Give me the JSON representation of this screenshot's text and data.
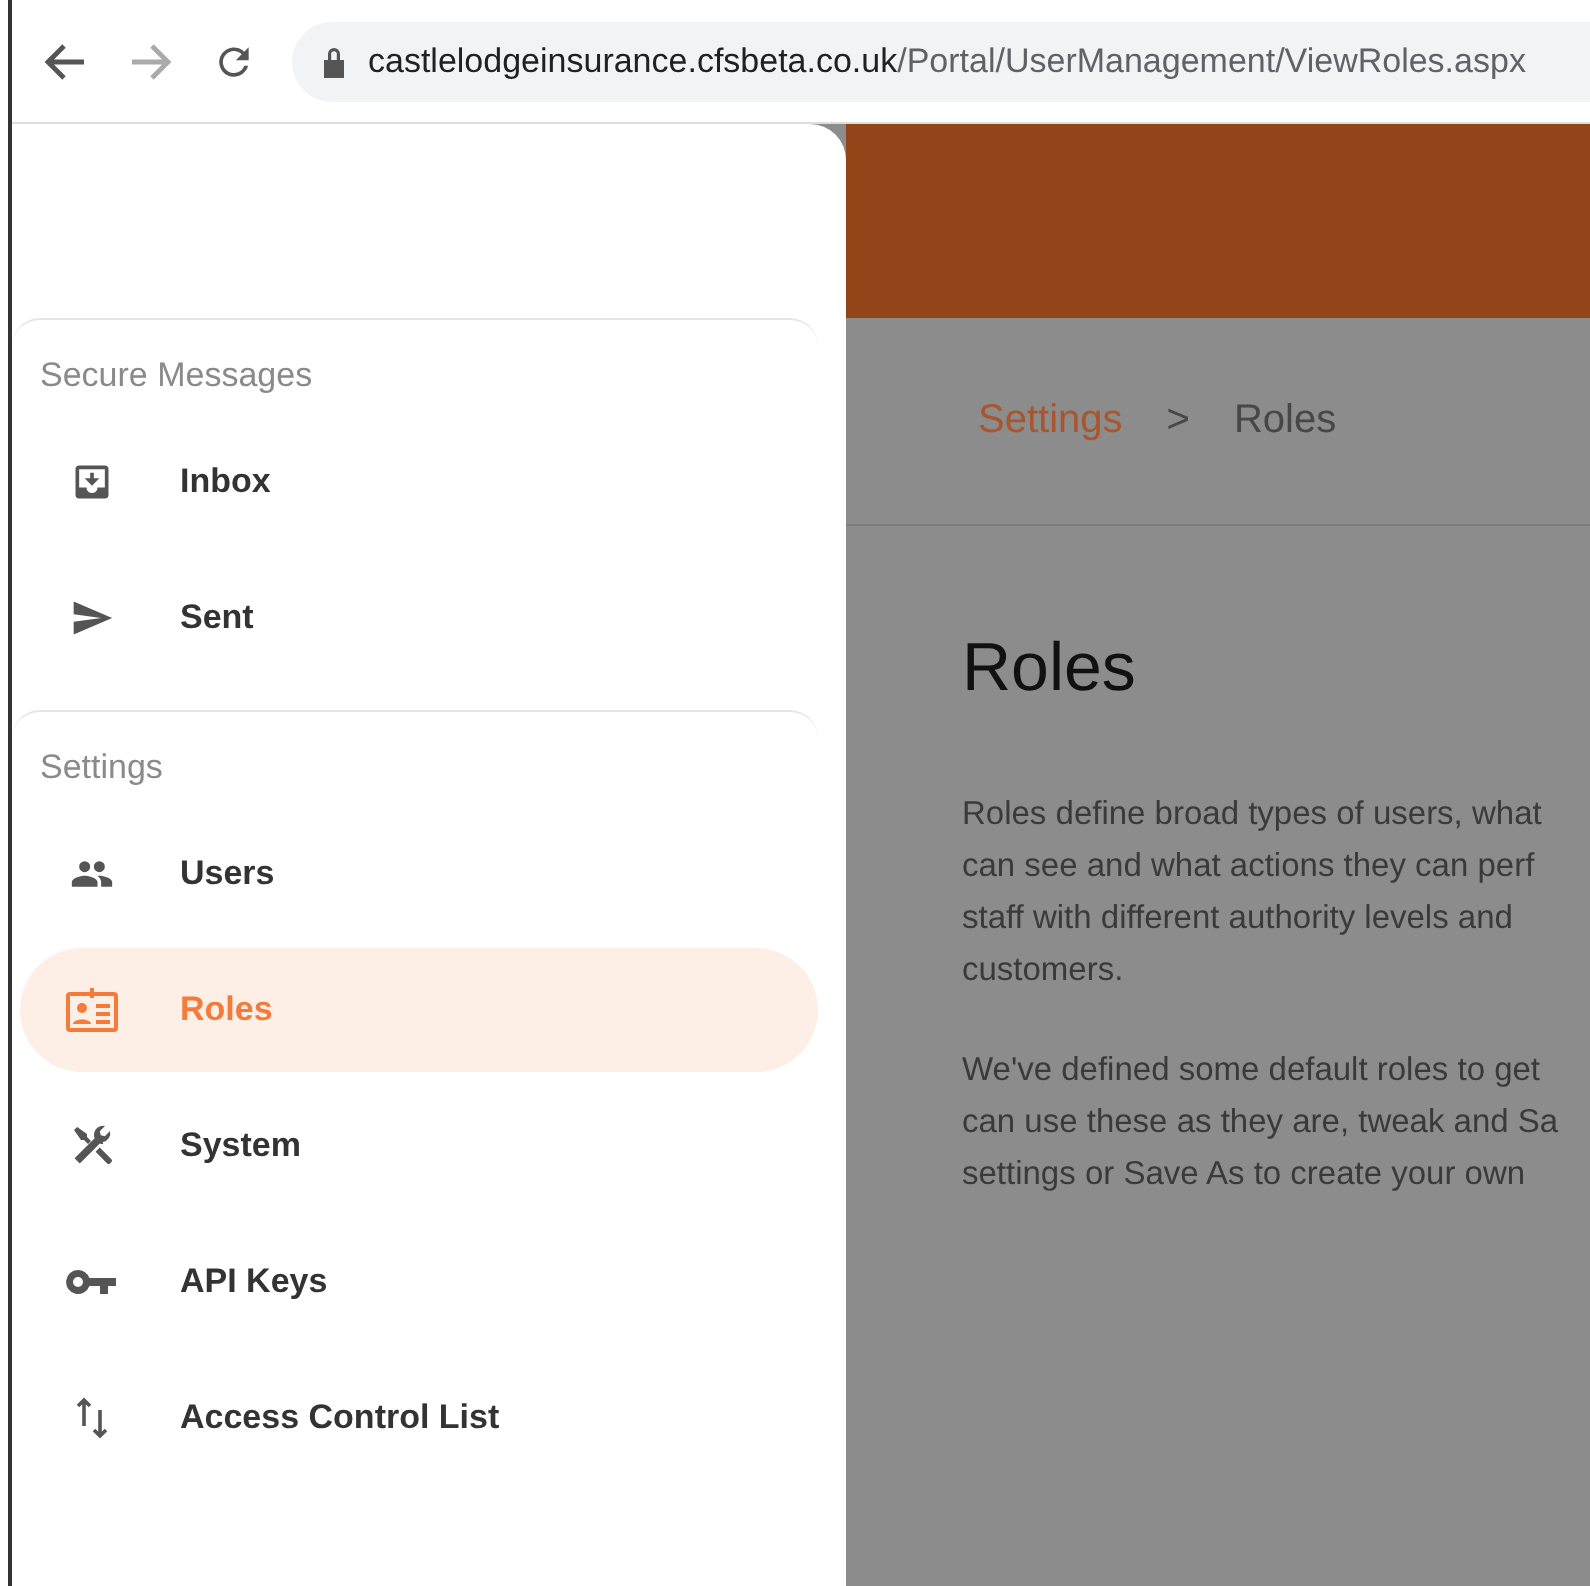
{
  "browser": {
    "url_host": "castlelodgeinsurance.cfsbeta.co.uk",
    "url_path": "/Portal/UserManagement/ViewRoles.aspx"
  },
  "sidebar": {
    "sections": [
      {
        "title": "Secure Messages",
        "items": [
          {
            "label": "Inbox",
            "selected": false
          },
          {
            "label": "Sent",
            "selected": false
          }
        ]
      },
      {
        "title": "Settings",
        "items": [
          {
            "label": "Users",
            "selected": false
          },
          {
            "label": "Roles",
            "selected": true
          },
          {
            "label": "System",
            "selected": false
          },
          {
            "label": "API Keys",
            "selected": false
          },
          {
            "label": "Access Control List",
            "selected": false
          }
        ]
      }
    ]
  },
  "breadcrumb": {
    "parent": "Settings",
    "separator": ">",
    "current": "Roles"
  },
  "page": {
    "title": "Roles",
    "paragraphs": [
      [
        "Roles define broad types of users, what",
        "can see and what actions they can perf",
        "staff with different authority levels and",
        "customers."
      ],
      [
        "We've defined some default roles to get",
        "can use these as they are, tweak and Sa",
        "settings or Save As to create your own"
      ]
    ]
  }
}
